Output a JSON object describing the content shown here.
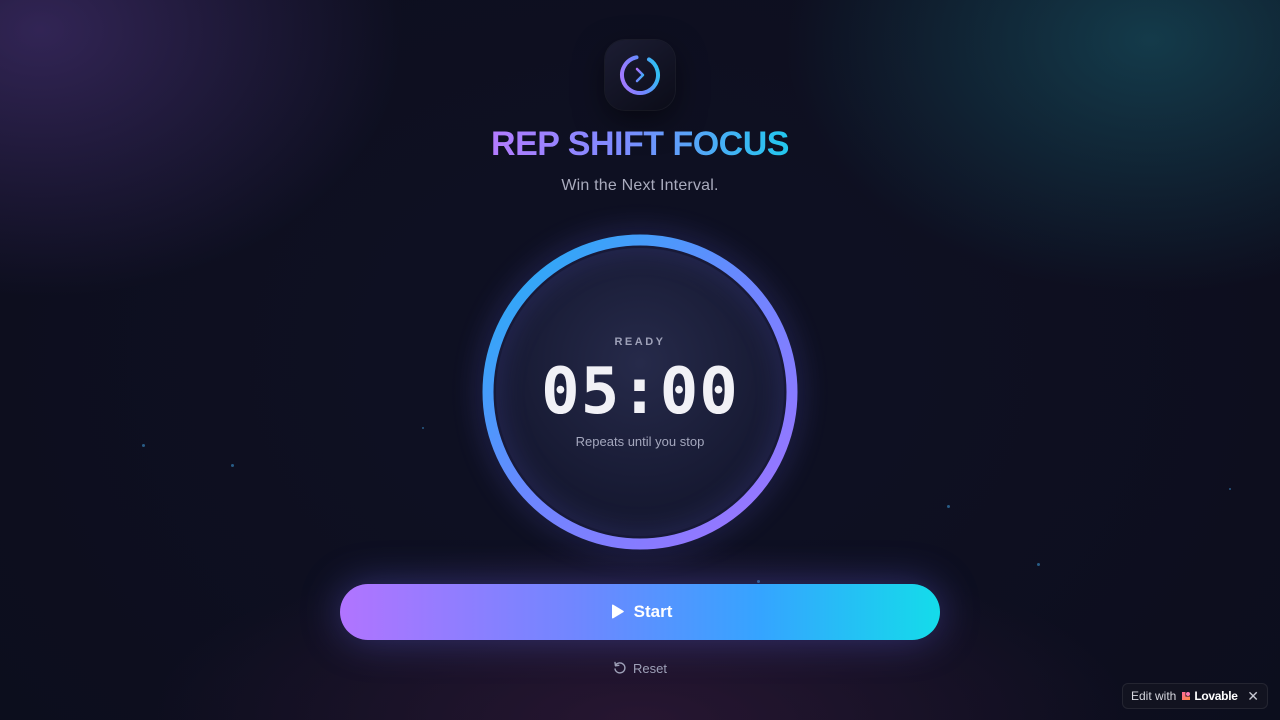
{
  "app": {
    "title": "REP SHIFT FOCUS",
    "tagline": "Win the Next Interval.",
    "logo_icon": "play-ring-icon"
  },
  "timer": {
    "status": "READY",
    "time": "05:00",
    "hint": "Repeats until you stop",
    "progress": 1.0
  },
  "controls": {
    "start_label": "Start",
    "start_icon": "play-icon",
    "reset_label": "Reset",
    "reset_icon": "reset-icon"
  },
  "badge": {
    "prefix": "Edit with",
    "brand": "Lovable",
    "close": "✕"
  },
  "colors": {
    "accent_purple": "#b174ff",
    "accent_blue": "#35a4ff",
    "accent_cyan": "#14dcea",
    "background": "#0c0d1c"
  }
}
